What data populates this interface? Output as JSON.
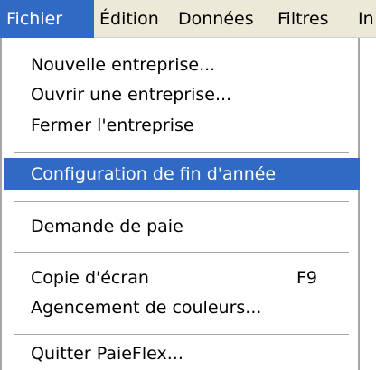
{
  "menubar": {
    "items": [
      {
        "label": "Fichier"
      },
      {
        "label": "Édition"
      },
      {
        "label": "Données"
      },
      {
        "label": "Filtres"
      },
      {
        "label": "In"
      }
    ]
  },
  "file_menu": {
    "items": [
      {
        "label": "Nouvelle entreprise..."
      },
      {
        "label": "Ouvrir une entreprise..."
      },
      {
        "label": "Fermer l'entreprise"
      },
      {
        "label": "Configuration de fin d'année"
      },
      {
        "label": "Demande de paie"
      },
      {
        "label": "Copie d'écran",
        "shortcut": "F9"
      },
      {
        "label": "Agencement de couleurs..."
      },
      {
        "label": "Quitter PaieFlex..."
      }
    ]
  },
  "colors": {
    "menubar_background": "#ece9d8",
    "highlight": "#316ac5",
    "menu_background": "#ffffff",
    "menu_border": "#a6a6a6"
  }
}
